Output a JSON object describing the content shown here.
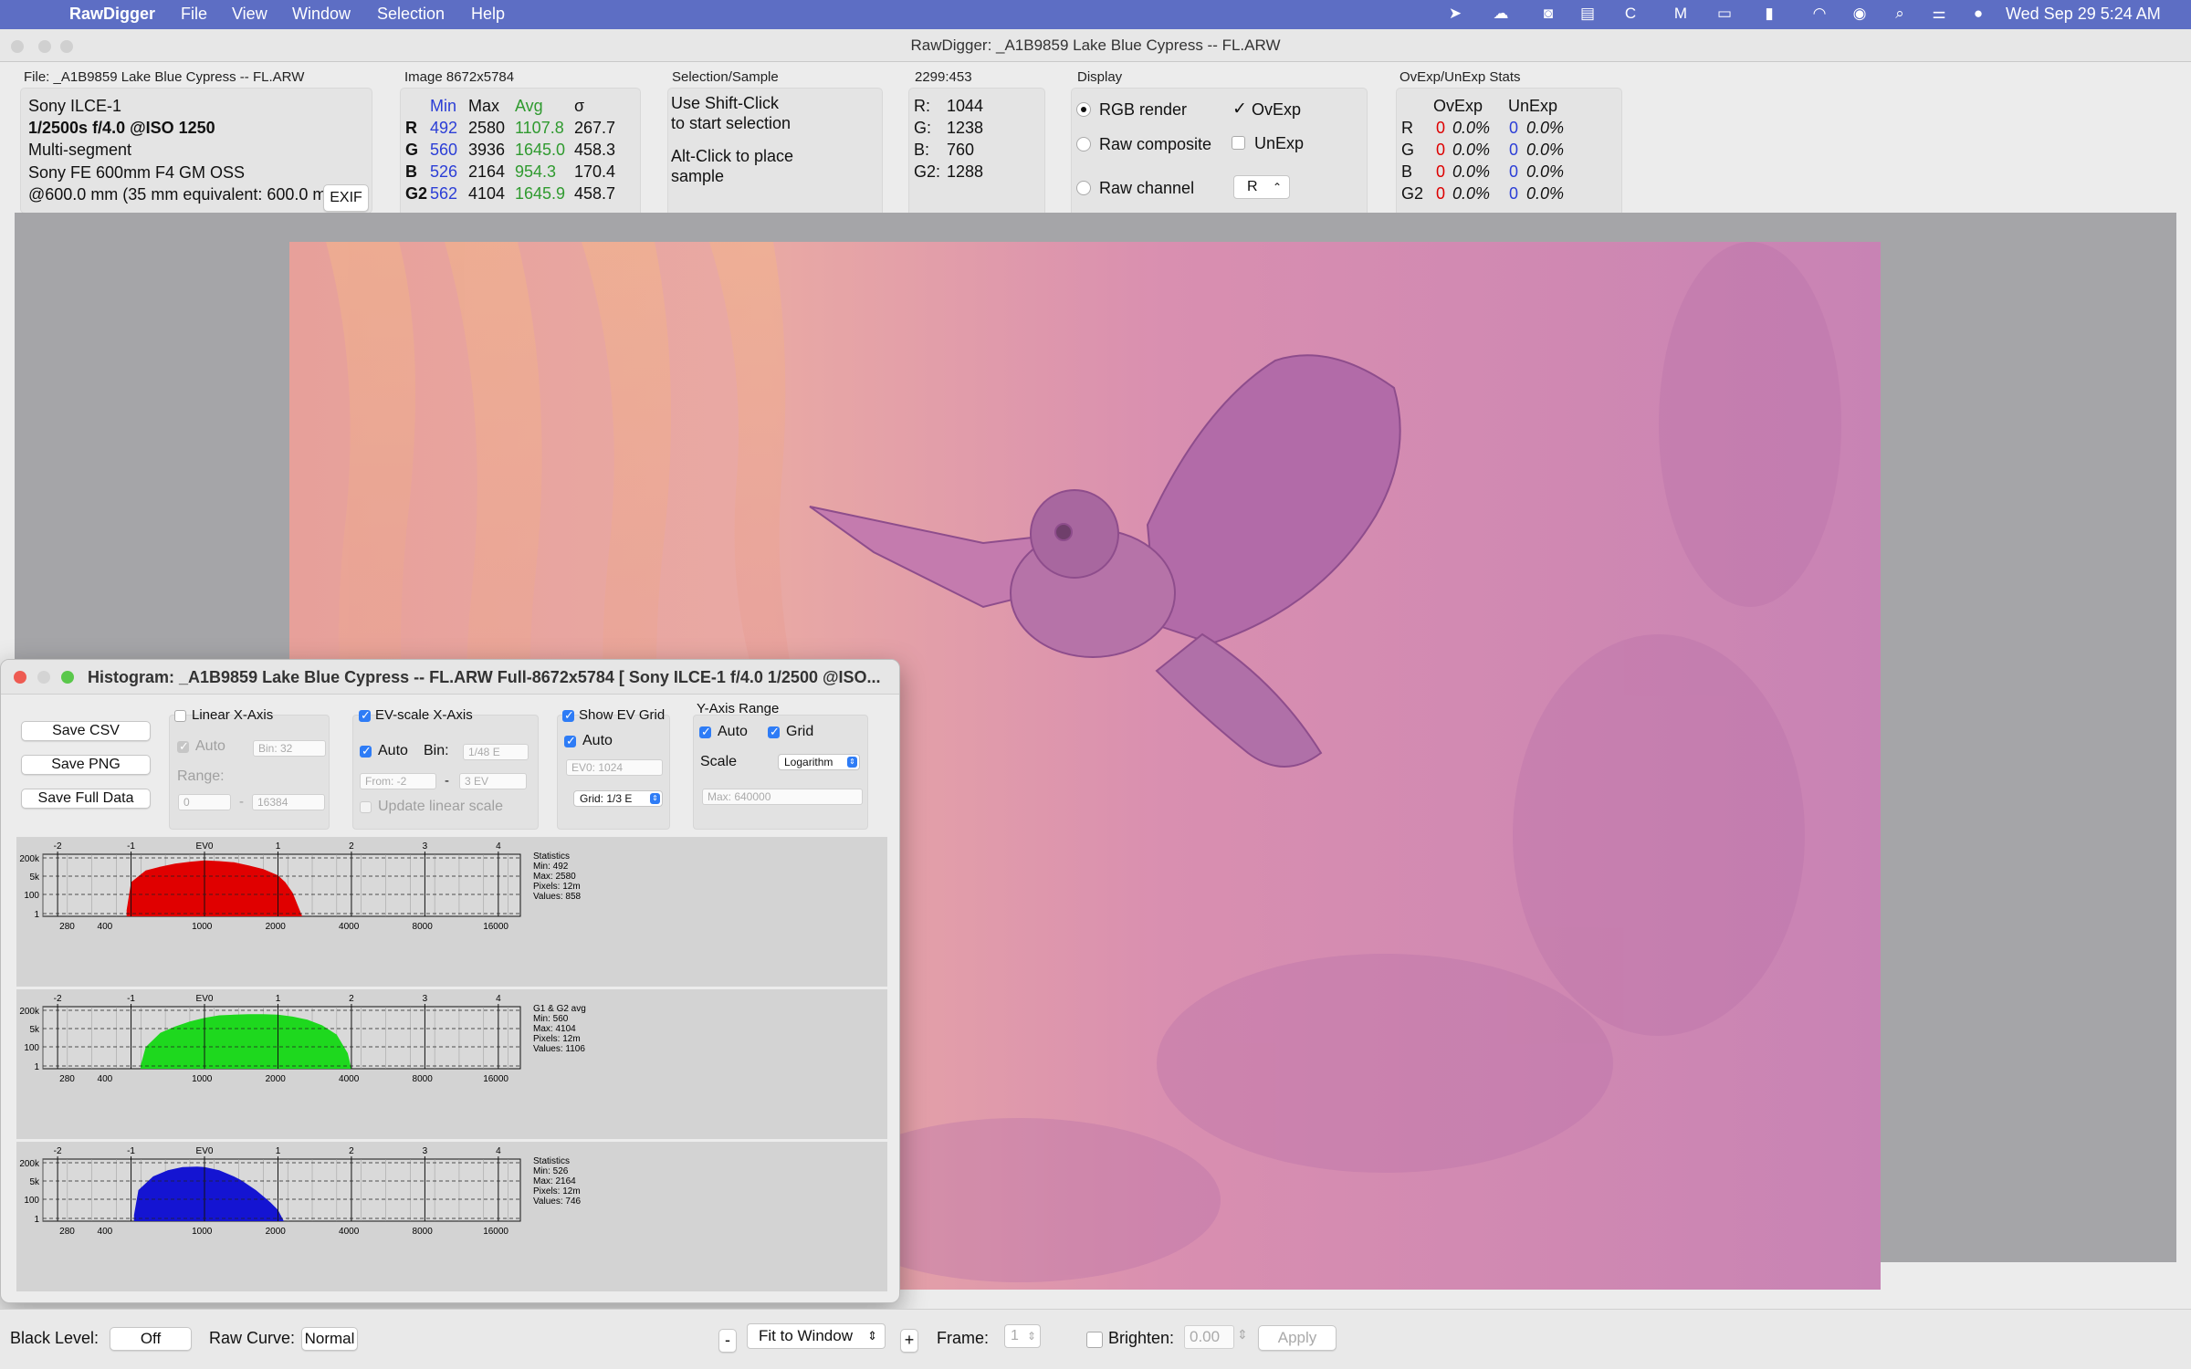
{
  "menubar": {
    "app": "RawDigger",
    "menus": [
      "File",
      "View",
      "Window",
      "Selection",
      "Help"
    ],
    "clock": "Wed Sep 29  5:24 AM",
    "status_icons": [
      "location-icon",
      "creative-cloud-icon",
      "timemachine-icon",
      "film-icon",
      "refresh-icon",
      "malwarebytes-icon",
      "display-icon",
      "battery-icon",
      "wifi-icon",
      "user-icon",
      "spotlight-icon",
      "control-center-icon",
      "siri-icon"
    ]
  },
  "window": {
    "title": "RawDigger: _A1B9859 Lake Blue Cypress -- FL.ARW"
  },
  "file_panel": {
    "header": "File: _A1B9859 Lake Blue Cypress -- FL.ARW",
    "camera": "Sony ILCE-1",
    "exposure": "1/2500s f/4.0 @ISO 1250",
    "mode": "Multi-segment",
    "lens": "Sony FE 600mm F4 GM OSS",
    "focal": "@600.0 mm (35 mm equivalent: 600.0 m",
    "exif_button": "EXIF"
  },
  "image_panel": {
    "header": "Image 8672x5784",
    "columns": [
      "Min",
      "Max",
      "Avg",
      "σ"
    ],
    "rows": [
      {
        "ch": "R",
        "min": "492",
        "max": "2580",
        "avg": "1107.8",
        "sd": "267.7"
      },
      {
        "ch": "G",
        "min": "560",
        "max": "3936",
        "avg": "1645.0",
        "sd": "458.3"
      },
      {
        "ch": "B",
        "min": "526",
        "max": "2164",
        "avg": "954.3",
        "sd": "170.4"
      },
      {
        "ch": "G2",
        "min": "562",
        "max": "4104",
        "avg": "1645.9",
        "sd": "458.7"
      }
    ]
  },
  "selection_panel": {
    "header": "Selection/Sample",
    "line1": "Use Shift-Click",
    "line2": "to start selection",
    "line3": "Alt-Click to place",
    "line4": "sample"
  },
  "sample_panel": {
    "header": "2299:453",
    "rows": [
      {
        "ch": "R:",
        "val": "1044"
      },
      {
        "ch": "G:",
        "val": "1238"
      },
      {
        "ch": "B:",
        "val": "760"
      },
      {
        "ch": "G2:",
        "val": "1288"
      }
    ]
  },
  "display_panel": {
    "header": "Display",
    "rgb_render": "RGB render",
    "raw_composite": "Raw composite",
    "raw_channel": "Raw channel",
    "ovexp": "OvExp",
    "unexp": "UnExp",
    "channel_value": "R"
  },
  "stats_panel": {
    "header": "OvExp/UnExp Stats",
    "ov_header": "OvExp",
    "un_header": "UnExp",
    "rows": [
      {
        "ch": "R",
        "ov": "0",
        "ovp": "0.0%",
        "un": "0",
        "unp": "0.0%"
      },
      {
        "ch": "G",
        "ov": "0",
        "ovp": "0.0%",
        "un": "0",
        "unp": "0.0%"
      },
      {
        "ch": "B",
        "ov": "0",
        "ovp": "0.0%",
        "un": "0",
        "unp": "0.0%"
      },
      {
        "ch": "G2",
        "ov": "0",
        "ovp": "0.0%",
        "un": "0",
        "unp": "0.0%"
      }
    ]
  },
  "histogram": {
    "title": "Histogram: _A1B9859 Lake Blue Cypress -- FL.ARW Full-8672x5784 [ Sony ILCE-1 f/4.0 1/2500 @ISO...",
    "save_csv": "Save CSV",
    "save_png": "Save PNG",
    "save_full": "Save Full Data",
    "linear_x": "Linear X-Axis",
    "auto": "Auto",
    "bin_label": "Bin:",
    "bin_32": "Bin: 32",
    "range": "Range:",
    "range_from": "0",
    "range_to": "16384",
    "ev_scale": "EV-scale X-Axis",
    "bin_48": "1/48 E",
    "from": "From: -2",
    "to": "3 EV",
    "update_linear": "Update linear scale",
    "show_ev_grid": "Show EV Grid",
    "ev0": "EV0: 1024",
    "grid": "Grid: 1/3 E",
    "y_range": "Y-Axis Range",
    "grid_label": "Grid",
    "scale": "Scale",
    "log": "Logarithm",
    "ymax": "Max: 640000",
    "ev_ticks": [
      "-2",
      "-1",
      "EV0",
      "1",
      "2",
      "3",
      "4"
    ],
    "x_ticks": [
      "280",
      "400",
      "1000",
      "2000",
      "4000",
      "8000",
      "16000"
    ],
    "y_ticks": [
      "200k",
      "5k",
      "100",
      "1"
    ],
    "dash": "-"
  },
  "chart_data": [
    {
      "type": "area",
      "color": "#e00000",
      "x_scale": "log2 (EV relative to 1024)",
      "xlim": [
        -2.2,
        4.3
      ],
      "stats": {
        "title": "Statistics",
        "min": "Min: 492",
        "max": "Max: 2580",
        "pixels": "Pixels: 12m",
        "values": "Values: 858"
      },
      "x": [
        -1.06,
        -1.0,
        -0.8,
        -0.6,
        -0.4,
        -0.2,
        0.0,
        0.2,
        0.4,
        0.6,
        0.8,
        1.0,
        1.1,
        1.2,
        1.33
      ],
      "y": [
        0.1,
        0.55,
        0.74,
        0.8,
        0.85,
        0.88,
        0.9,
        0.89,
        0.87,
        0.82,
        0.76,
        0.66,
        0.55,
        0.38,
        0.0
      ]
    },
    {
      "type": "area",
      "color": "#1ed81e",
      "x_scale": "log2 (EV relative to 1024)",
      "xlim": [
        -2.2,
        4.3
      ],
      "stats": {
        "title": "G1 & G2 avg",
        "min": "Min: 560",
        "max": "Max: 4104",
        "pixels": "Pixels: 12m",
        "values": "Values: 1106"
      },
      "x": [
        -0.87,
        -0.8,
        -0.6,
        -0.4,
        -0.2,
        0.0,
        0.2,
        0.4,
        0.6,
        0.8,
        1.0,
        1.2,
        1.4,
        1.6,
        1.8,
        1.95,
        2.0
      ],
      "y": [
        0.05,
        0.35,
        0.58,
        0.68,
        0.76,
        0.82,
        0.86,
        0.87,
        0.88,
        0.88,
        0.87,
        0.84,
        0.79,
        0.7,
        0.55,
        0.25,
        0.0
      ]
    },
    {
      "type": "area",
      "color": "#1414d2",
      "x_scale": "log2 (EV relative to 1024)",
      "xlim": [
        -2.2,
        4.3
      ],
      "stats": {
        "title": "Statistics",
        "min": "Min: 526",
        "max": "Max: 2164",
        "pixels": "Pixels: 12m",
        "values": "Values: 746"
      },
      "x": [
        -0.96,
        -0.9,
        -0.7,
        -0.5,
        -0.3,
        -0.1,
        0.0,
        0.2,
        0.4,
        0.5,
        0.6,
        0.7,
        0.8,
        0.9,
        1.0,
        1.08
      ],
      "y": [
        0.1,
        0.5,
        0.72,
        0.82,
        0.87,
        0.88,
        0.87,
        0.82,
        0.72,
        0.66,
        0.58,
        0.5,
        0.4,
        0.3,
        0.18,
        0.0
      ]
    }
  ],
  "statusbar": {
    "black_level": "Black Level:",
    "off": "Off",
    "raw_curve": "Raw Curve:",
    "normal": "Normal",
    "minus": "-",
    "fit": "Fit to Window",
    "plus": "+",
    "frame": "Frame:",
    "frame_value": "1",
    "brighten": "Brighten:",
    "brighten_value": "0.00",
    "apply": "Apply"
  }
}
